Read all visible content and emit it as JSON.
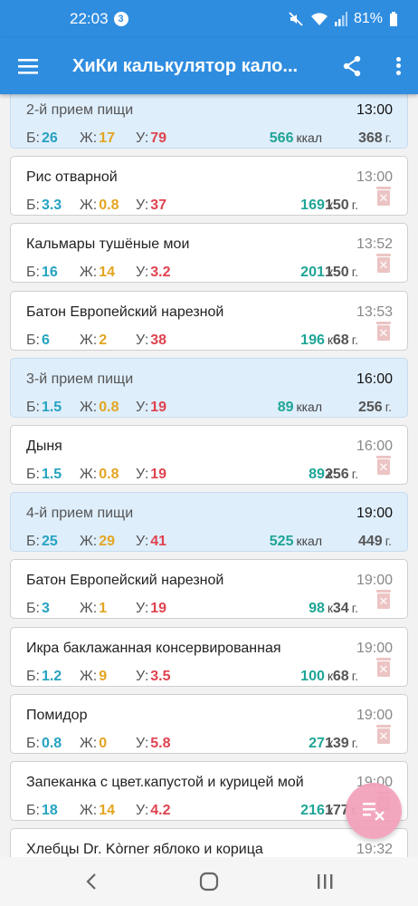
{
  "status": {
    "time": "22:03",
    "notification_count": "3",
    "battery": "81%"
  },
  "appbar": {
    "title": "ХиКи калькулятор кало..."
  },
  "macro_labels": {
    "protein": "Б:",
    "fat": "Ж:",
    "carbs": "У:"
  },
  "units": {
    "kcal_meal": "ккал",
    "kcal_food": "к",
    "grams": "г."
  },
  "entries": [
    {
      "type": "meal",
      "name": "2-й прием пищи",
      "time": "13:00",
      "protein": "26",
      "fat": "17",
      "carbs": "79",
      "kcal": "566",
      "weight": "368"
    },
    {
      "type": "food",
      "name": "Рис отварной",
      "time": "13:00",
      "protein": "3.3",
      "fat": "0.8",
      "carbs": "37",
      "kcal": "169",
      "weight": "150"
    },
    {
      "type": "food",
      "name": "Кальмары тушёные мои",
      "time": "13:52",
      "protein": "16",
      "fat": "14",
      "carbs": "3.2",
      "kcal": "201",
      "weight": "150"
    },
    {
      "type": "food",
      "name": "Батон Европейский нарезной",
      "time": "13:53",
      "protein": "6",
      "fat": "2",
      "carbs": "38",
      "kcal": "196",
      "weight": "68"
    },
    {
      "type": "meal",
      "name": "3-й прием пищи",
      "time": "16:00",
      "protein": "1.5",
      "fat": "0.8",
      "carbs": "19",
      "kcal": "89",
      "weight": "256"
    },
    {
      "type": "food",
      "name": "Дыня",
      "time": "16:00",
      "protein": "1.5",
      "fat": "0.8",
      "carbs": "19",
      "kcal": "89",
      "weight": "256"
    },
    {
      "type": "meal",
      "name": "4-й прием пищи",
      "time": "19:00",
      "protein": "25",
      "fat": "29",
      "carbs": "41",
      "kcal": "525",
      "weight": "449"
    },
    {
      "type": "food",
      "name": "Батон Европейский нарезной",
      "time": "19:00",
      "protein": "3",
      "fat": "1",
      "carbs": "19",
      "kcal": "98",
      "weight": "34"
    },
    {
      "type": "food",
      "name": "Икра баклажанная консервированная",
      "time": "19:00",
      "protein": "1.2",
      "fat": "9",
      "carbs": "3.5",
      "kcal": "100",
      "weight": "68"
    },
    {
      "type": "food",
      "name": "Помидор",
      "time": "19:00",
      "protein": "0.8",
      "fat": "0",
      "carbs": "5.8",
      "kcal": "27",
      "weight": "139"
    },
    {
      "type": "food",
      "name": "Запеканка с цвет.капустой и курицей мой",
      "time": "19:00",
      "protein": "18",
      "fat": "14",
      "carbs": "4.2",
      "kcal": "216",
      "weight": "177"
    },
    {
      "type": "food",
      "name": "Хлебцы Dr. Kòrner яблоко и корица",
      "time": "19:32",
      "protein": "",
      "fat": "",
      "carbs": "",
      "kcal": "",
      "weight": ""
    }
  ],
  "colors": {
    "primary": "#2f8de0",
    "protein": "#25a3c0",
    "fat": "#e3a522",
    "carbs": "#e0424f",
    "kcal": "#1ea596",
    "meal_bg": "#dfeefb",
    "fab": "#f2a0ba"
  },
  "icons": {
    "menu": "hamburger-icon",
    "share": "share-icon",
    "more": "more-vert-icon",
    "delete": "delete-icon",
    "fab": "playlist-remove-icon"
  }
}
